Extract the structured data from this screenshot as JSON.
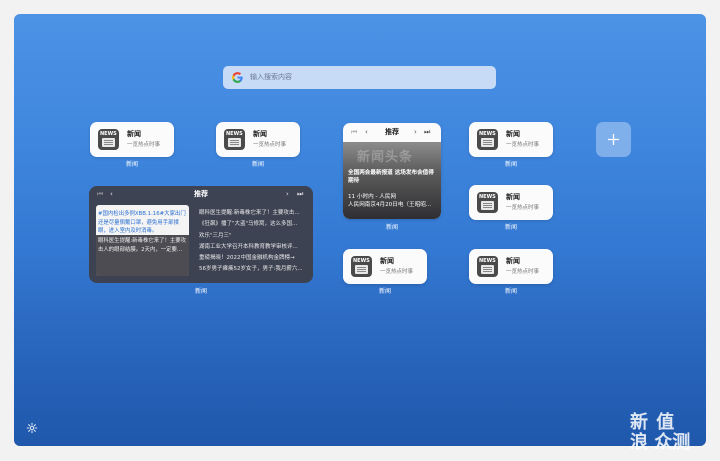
{
  "search": {
    "placeholder": "输入搜索内容"
  },
  "widgets": {
    "w1": {
      "title": "新闻",
      "subtitle": "一览热点时事",
      "caption": "新闻",
      "icon_text": "NEWS"
    },
    "w2": {
      "title": "新闻",
      "subtitle": "一览热点时事",
      "caption": "新闻",
      "icon_text": "NEWS"
    },
    "w3": {
      "title": "新闻",
      "subtitle": "一览热点时事",
      "caption": "新闻",
      "icon_text": "NEWS"
    },
    "w4": {
      "title": "新闻",
      "subtitle": "一览热点时事",
      "caption": "新闻",
      "icon_text": "NEWS"
    },
    "w5": {
      "title": "新闻",
      "subtitle": "一览热点时事",
      "caption": "新闻",
      "icon_text": "NEWS"
    },
    "w6": {
      "title": "新闻",
      "subtitle": "一览热点时事",
      "caption": "新闻",
      "icon_text": "NEWS"
    }
  },
  "big_panel": {
    "title": "推荐",
    "caption": "新闻",
    "controls": {
      "first": "⏮",
      "prev": "‹",
      "next": "›",
      "last": "⏭"
    },
    "thumb_text_1": "#国内检出多例XBB.1.16#大家出门还是尽量佩戴口罩，避免用手部揉眼，进入室内及时消毒。",
    "thumb_text_2": "眼科医生提醒:新毒株它来了！主要攻击人的眼部结膜。2天内，一定要...",
    "headlines": [
      "眼科医生提醒:新毒株它来了！主要攻击...",
      "《狂飙》播了\"大盗\"马修窝，这么多国...",
      "欢乐\"三月三\"",
      "湖南工业大学召开本科教育教学审核评...",
      "重磅揭晓！2022中国金融机构金牌榜→",
      "56岁男子瘫痪52岁女子，男子:我月薪六..."
    ]
  },
  "rec_panel": {
    "title": "推荐",
    "caption": "新闻",
    "controls": {
      "first": "⏮",
      "prev": "‹",
      "next": "›",
      "last": "⏭"
    },
    "watermark": "新闻头条",
    "headline": "全国两会最新报道 这场发布会值得期待",
    "time": "11 小时内 - 人民网",
    "source": "人民网南京4月20日电（王昭昭..."
  },
  "brand": {
    "line1": "新 值",
    "line2": "浪 众测"
  },
  "colors": {
    "accent": "#3f86de",
    "panel_dark": "#3e3e46"
  }
}
